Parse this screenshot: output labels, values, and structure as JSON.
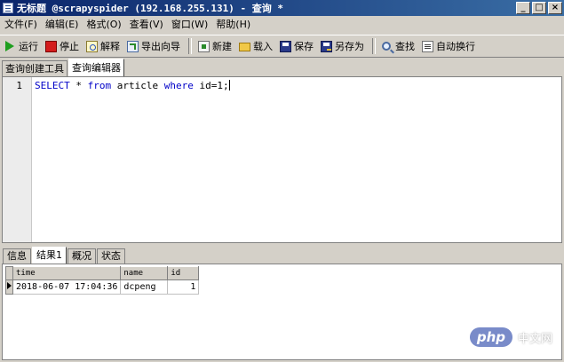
{
  "window": {
    "title": "无标题 @scrapyspider (192.168.255.131) - 查询 *",
    "controls": [
      "_",
      "□",
      "×"
    ]
  },
  "menu": [
    "文件(F)",
    "编辑(E)",
    "格式(O)",
    "查看(V)",
    "窗口(W)",
    "帮助(H)"
  ],
  "toolbar": {
    "run": "运行",
    "stop": "停止",
    "explain": "解释",
    "export_wizard": "导出向导",
    "new": "新建",
    "load": "载入",
    "save": "保存",
    "save_as": "另存为",
    "find": "查找",
    "word_wrap": "自动换行"
  },
  "top_tabs": [
    "查询创建工具",
    "查询编辑器"
  ],
  "editor": {
    "line_number": "1",
    "code": {
      "select": "SELECT",
      "star": " * ",
      "from": "from",
      "table": " article ",
      "where": "where",
      "cond": " id=1;"
    }
  },
  "bottom_tabs": [
    "信息",
    "结果1",
    "概况",
    "状态"
  ],
  "result": {
    "columns": [
      "time",
      "name",
      "id"
    ],
    "rows": [
      {
        "time": "2018-06-07 17:04:36",
        "name": "dcpeng",
        "id": "1"
      }
    ]
  },
  "watermark": {
    "badge": "php",
    "text": "中文网"
  }
}
